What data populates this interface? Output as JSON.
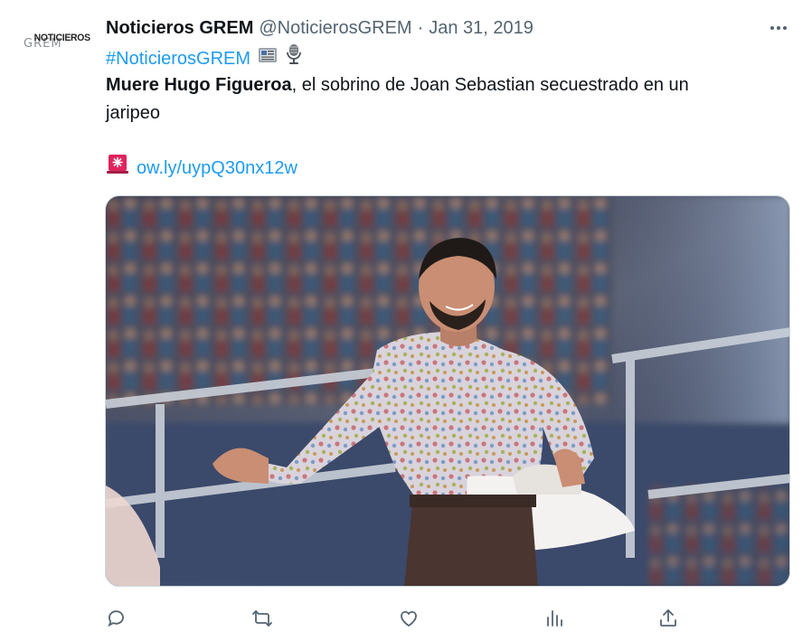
{
  "tweet": {
    "author_name": "Noticieros GREM",
    "handle": "@NoticierosGREM",
    "separator": "·",
    "date": "Jan 31, 2019",
    "avatar": {
      "logo_top": "NOTICIEROS",
      "logo_bottom": "GREM"
    },
    "hashtag": "#NoticierosGREM",
    "hashtag_emojis": [
      "newspaper-icon",
      "microphone-icon"
    ],
    "text_bold": "Muere Hugo Figueroa",
    "text_rest": ", el sobrino de Joan Sebastian secuestrado en un",
    "text_line2": "jaripeo",
    "link_emoji": "siren-icon",
    "link": "ow.ly/uypQ30nx12w"
  },
  "actions": [
    "reply-icon",
    "retweet-icon",
    "like-icon",
    "views-icon",
    "share-icon"
  ],
  "colors": {
    "link": "#1d9bf0",
    "secondary_text": "#536471",
    "primary_text": "#0f1419"
  }
}
